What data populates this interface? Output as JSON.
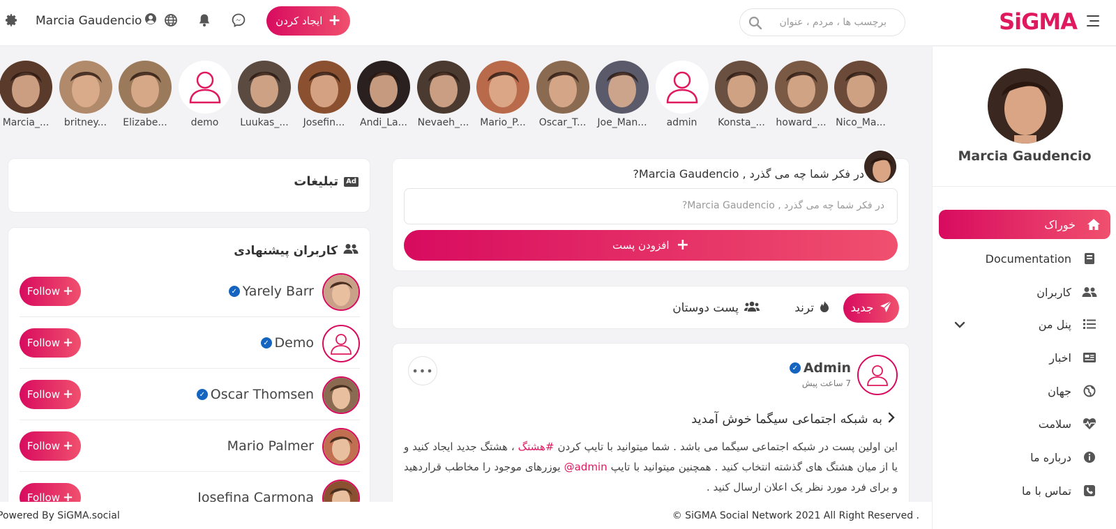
{
  "app": {
    "logo": "SiGMA"
  },
  "header": {
    "search_placeholder": "برچسب ها ، مردم ، عنوان",
    "create_label": "ایجاد کردن",
    "user_name": "Marcia Gaudencio"
  },
  "sidebar": {
    "profile_name": "Marcia Gaudencio",
    "items": [
      {
        "label": "خوراک",
        "icon": "home-icon"
      },
      {
        "label": "Documentation",
        "icon": "book-icon"
      },
      {
        "label": "کاربران",
        "icon": "users-icon"
      },
      {
        "label": "پنل من",
        "icon": "list-icon"
      },
      {
        "label": "اخبار",
        "icon": "newspaper-icon"
      },
      {
        "label": "جهان",
        "icon": "globe-icon"
      },
      {
        "label": "سلامت",
        "icon": "heartbeat-icon"
      },
      {
        "label": "درباره ما",
        "icon": "info-icon"
      },
      {
        "label": "تماس با ما",
        "icon": "phone-icon"
      }
    ]
  },
  "stories": [
    {
      "name": "Nico_Ma...",
      "color": "#6b4a3a"
    },
    {
      "name": "howard_...",
      "color": "#7a5a45"
    },
    {
      "name": "Konsta_...",
      "color": "#6a5040"
    },
    {
      "name": "admin",
      "color": ""
    },
    {
      "name": "Joe_Man...",
      "color": "#5a5a6a"
    },
    {
      "name": "Oscar_T...",
      "color": "#8a6a50"
    },
    {
      "name": "Mario_P...",
      "color": "#b86a4a"
    },
    {
      "name": "Nevaeh_...",
      "color": "#4a3a30"
    },
    {
      "name": "Andi_La...",
      "color": "#2a2020"
    },
    {
      "name": "Josefin...",
      "color": "#8a5030"
    },
    {
      "name": "Luukas_...",
      "color": "#5a4a40"
    },
    {
      "name": "demo",
      "color": ""
    },
    {
      "name": "Elizabe...",
      "color": "#9a7a5a"
    },
    {
      "name": "britney...",
      "color": "#b08a6a"
    },
    {
      "name": "Marcia_...",
      "color": "#5a3a2a"
    }
  ],
  "composer": {
    "prompt": "در فکر شما چه می گذرد , Marcia Gaudencio?",
    "placeholder": "در فکر شما چه می گذرد , Marcia Gaudencio?",
    "add_post_label": "افزودن پست"
  },
  "tabs": [
    {
      "label": "جدید",
      "icon": "paper-plane-icon"
    },
    {
      "label": "ترند",
      "icon": "fire-icon"
    },
    {
      "label": "پست دوستان",
      "icon": "users-icon"
    }
  ],
  "post": {
    "author": "Admin",
    "time": "7 ساعت پیش",
    "title": "به شبکه اجتماعی سیگما خوش آمدید",
    "body_1": "این اولین پست در شبکه اجتماعی سیگما می باشد . شما میتوانید با تایپ کردن ",
    "hashtag": "#هشتگ",
    "body_2": " ، هشتگ جدید ایجاد کنید و یا از میان هشتگ های گذشته انتخاب کنید . همچنین میتوانید با تایپ ",
    "mention": "admin@",
    "body_3": " یوزرهای موجود را مخاطب قراردهید و برای فرد مورد نظر یک اعلان ارسال کنید ."
  },
  "ads": {
    "title": "تبلیغات",
    "badge": "Ad"
  },
  "suggested": {
    "title": "کاربران پیشنهادی",
    "follow_label": "Follow",
    "users": [
      {
        "name": "Yarely Barr",
        "verified": true
      },
      {
        "name": "Demo",
        "verified": true
      },
      {
        "name": "Oscar Thomsen",
        "verified": true
      },
      {
        "name": "Mario Palmer",
        "verified": false
      },
      {
        "name": "Josefina Carmona",
        "verified": false
      }
    ]
  },
  "footer": {
    "left": "Powered By SiGMA.social",
    "right": "© SiGMA Social Network 2021 All Right Reserved ."
  },
  "colors": {
    "accent": "#e0195f",
    "accent_light": "#f0506e",
    "verified": "#1565c0"
  }
}
